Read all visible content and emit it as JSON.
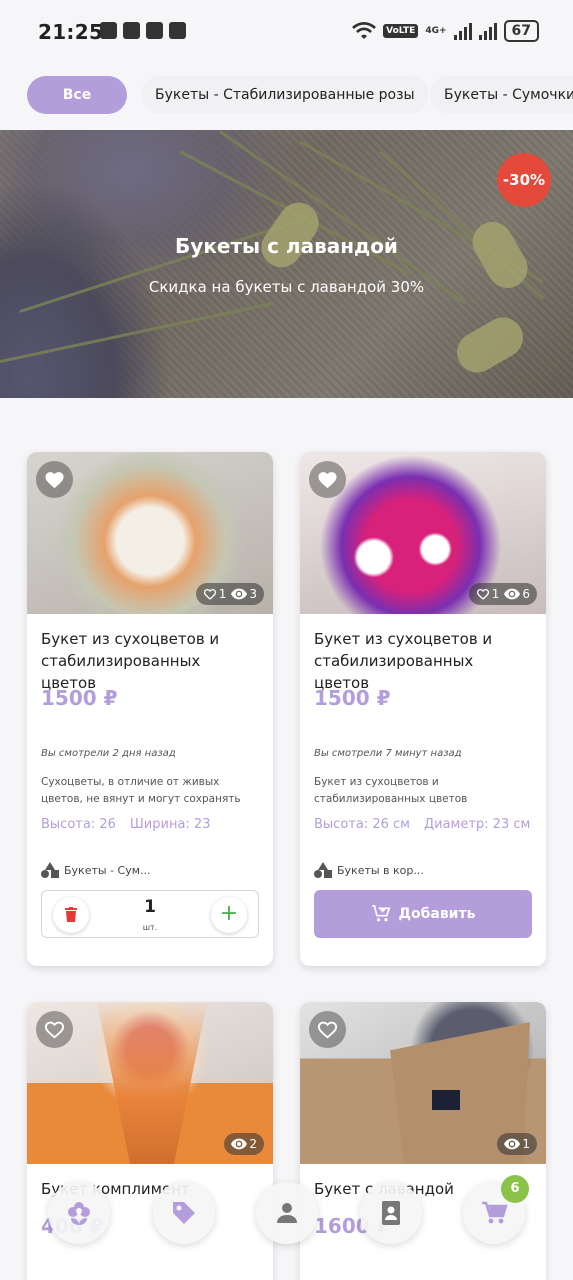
{
  "status_bar": {
    "time": "21:25",
    "volte": "VoLTE",
    "network": "4G+",
    "battery": "67"
  },
  "categories": [
    {
      "label": "Все",
      "active": true
    },
    {
      "label": "Букеты - Стабилизированные розы",
      "active": false
    },
    {
      "label": "Букеты - Сумочки \"",
      "active": false
    }
  ],
  "banner": {
    "title": "Букеты с лавандой",
    "subtitle": "Скидка на букеты с лавандой 30%",
    "discount": "-30%"
  },
  "products": [
    {
      "name": "Букет из сухоцветов и стабилизированных цветов",
      "price": "1500 ₽",
      "likes": "1",
      "views": "3",
      "viewed": "Вы смотрели 2 дня назад",
      "description": "Сухоцветы, в отличие от живых цветов, не вянут и могут сохранять свой привлек...",
      "dims": [
        "Высота: 26",
        "Ширина: 23"
      ],
      "category": "Букеты - Сум...",
      "in_cart": true,
      "quantity": "1",
      "unit": "шт."
    },
    {
      "name": "Букет из сухоцветов и стабилизированных цветов",
      "price": "1500 ₽",
      "likes": "1",
      "views": "6",
      "viewed": "Вы смотрели 7 минут назад",
      "description": "Букет из сухоцветов и стабилизированных цветов",
      "dims": [
        "Высота: 26 см",
        "Диаметр: 23 см"
      ],
      "category": "Букеты в кор...",
      "in_cart": false,
      "add_label": "Добавить"
    },
    {
      "name": "Букет комплимент",
      "price": "400 ₽",
      "views": "2"
    },
    {
      "name": "Букет с лавандой",
      "price": "1600 ₽",
      "views": "1"
    }
  ],
  "bottom_nav": {
    "items": [
      "flower-icon",
      "tag-icon",
      "person-icon",
      "contacts-icon",
      "cart-icon"
    ],
    "cart_count": "6"
  },
  "colors": {
    "accent": "#b39ddb",
    "discount": "#e34a3c",
    "badge": "#8bc34a"
  }
}
